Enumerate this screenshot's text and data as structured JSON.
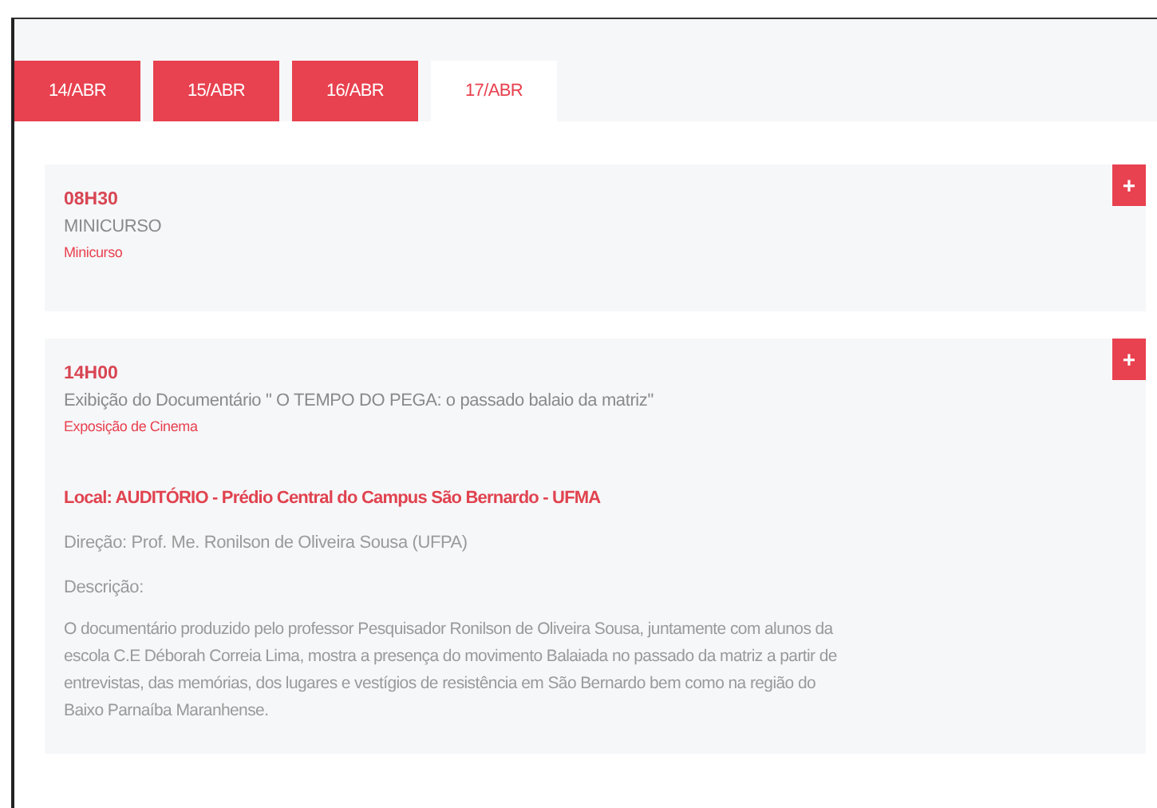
{
  "tabs": [
    {
      "label": "14/ABR",
      "selected": false
    },
    {
      "label": "15/ABR",
      "selected": false
    },
    {
      "label": "16/ABR",
      "selected": false
    },
    {
      "label": "17/ABR",
      "selected": true
    }
  ],
  "events": [
    {
      "time": "08H30",
      "title": "MINICURSO",
      "category": "Minicurso",
      "expand_button": "+"
    },
    {
      "time": "14H00",
      "title": "Exibição do Documentário \" O TEMPO DO PEGA: o passado balaio da matriz\"",
      "category": "Exposição de Cinema",
      "expand_button": "+",
      "location": "Local: AUDITÓRIO - Prédio Central do Campus São Bernardo - UFMA",
      "direction": "Direção: Prof. Me. Ronilson de Oliveira Sousa (UFPA)",
      "description_label": "Descrição:",
      "description": "O documentário produzido pelo professor Pesquisador Ronilson de Oliveira Sousa, juntamente com alunos da escola C.E Déborah Correia Lima, mostra a presença do movimento Balaiada no passado da matriz a partir de entrevistas, das memórias, dos lugares e vestígios de resistência em São Bernardo bem como na região do Baixo Parnaíba Maranhense."
    }
  ]
}
